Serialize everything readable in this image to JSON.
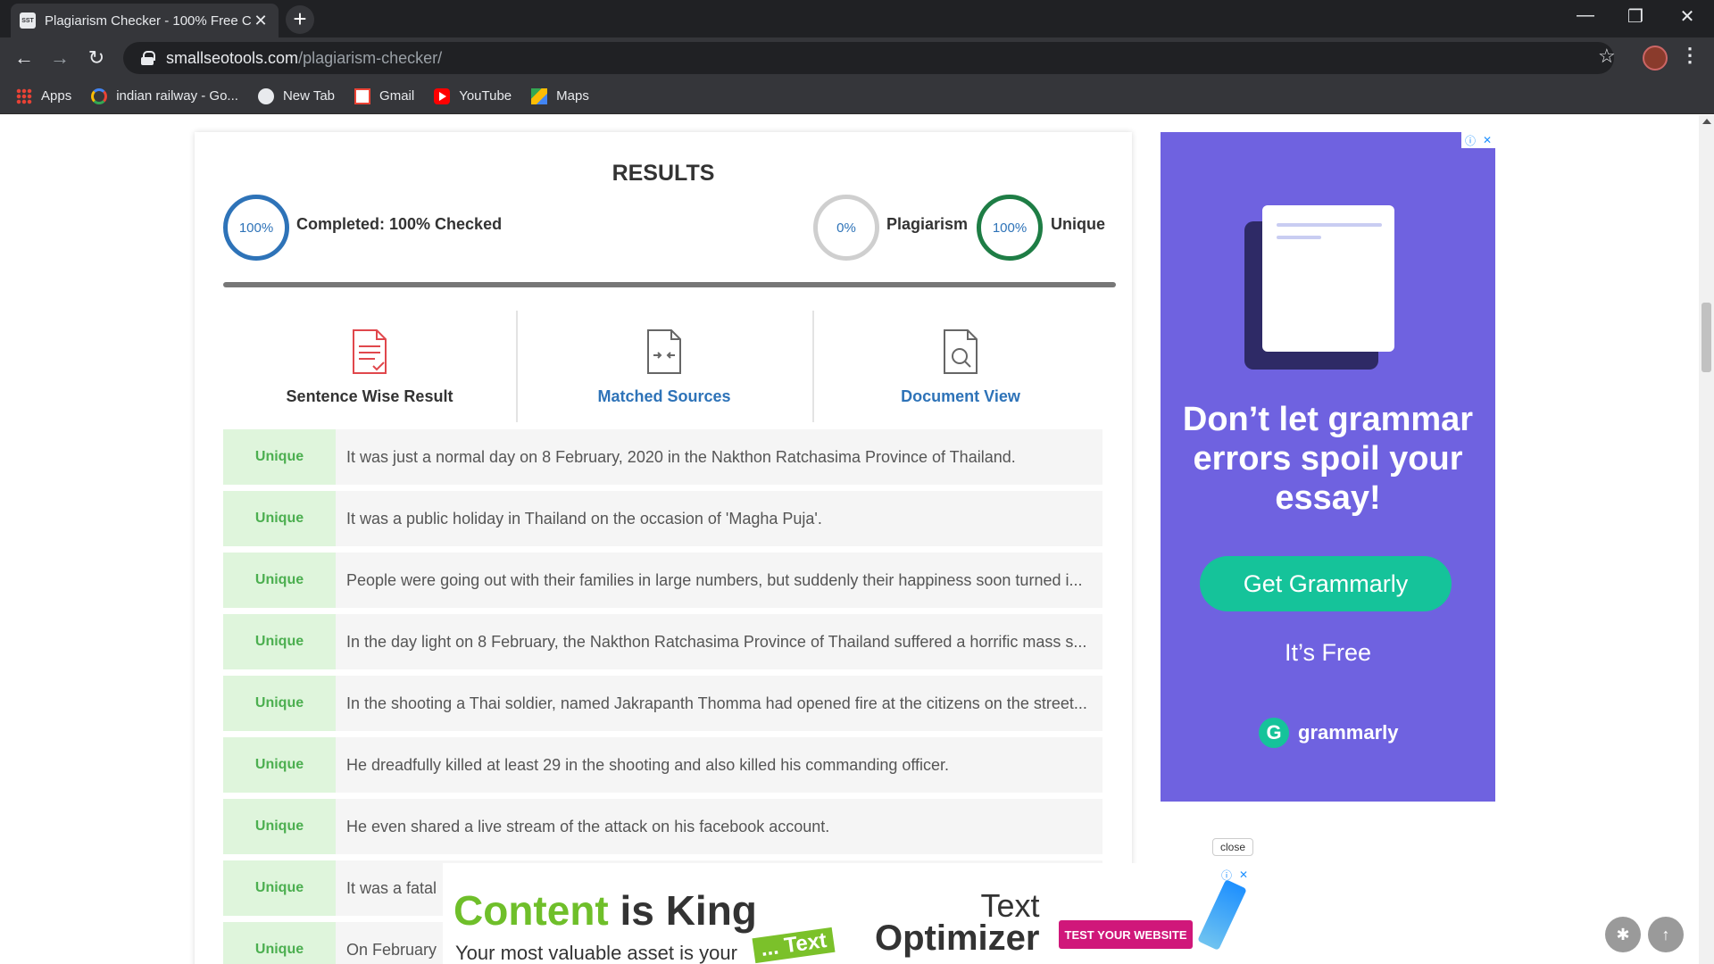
{
  "browser": {
    "tab_title": "Plagiarism Checker - 100% Free C",
    "tab_favicon_text": "SST",
    "url_host": "smallseotools.com",
    "url_path": "/plagiarism-checker/",
    "bookmarks": [
      "Apps",
      "indian railway - Go...",
      "New Tab",
      "Gmail",
      "YouTube",
      "Maps"
    ]
  },
  "results": {
    "heading": "RESULTS",
    "completed_percent": "100%",
    "completed_label": "Completed: 100% Checked",
    "plagiarism_percent": "0%",
    "plagiarism_label": "Plagiarism",
    "unique_percent": "100%",
    "unique_label": "Unique",
    "progress_fraction": 1.0
  },
  "view_tabs": [
    {
      "label": "Sentence Wise Result",
      "active": true,
      "icon": "sentence-document-icon"
    },
    {
      "label": "Matched Sources",
      "active": false,
      "icon": "compare-document-icon"
    },
    {
      "label": "Document View",
      "active": false,
      "icon": "search-document-icon"
    }
  ],
  "sentences": [
    {
      "status": "Unique",
      "text": "It was just a normal day on 8 February, 2020 in the Nakthon Ratchasima Province of Thailand."
    },
    {
      "status": "Unique",
      "text": "It was a public holiday in Thailand on the occasion of 'Magha Puja'."
    },
    {
      "status": "Unique",
      "text": "People were going out with their families in large numbers, but suddenly their happiness soon turned i..."
    },
    {
      "status": "Unique",
      "text": "In the day light on 8 February, the Nakthon Ratchasima Province of Thailand suffered a horrific mass s..."
    },
    {
      "status": "Unique",
      "text": "In the shooting a Thai soldier, named Jakrapanth Thomma had opened fire at the citizens on the street..."
    },
    {
      "status": "Unique",
      "text": "He dreadfully killed at least 29 in the shooting and also killed his commanding officer."
    },
    {
      "status": "Unique",
      "text": "He even shared a live stream of the attack on his facebook account."
    },
    {
      "status": "Unique",
      "text": "It was a fatal"
    },
    {
      "status": "Unique",
      "text": "On February"
    }
  ],
  "ad_right": {
    "headline": "Don’t let grammar errors spoil your essay!",
    "button": "Get Grammarly",
    "free": "It’s Free",
    "brand": "grammarly",
    "brand_color": "#15c39a",
    "bg_color": "#6f62e0"
  },
  "ad_bottom": {
    "close": "close",
    "title_a": "Content",
    "title_b": "is",
    "title_c": "King",
    "subtitle": "Your most valuable asset is your",
    "tag": "... Text",
    "product_a": "Text",
    "product_b": "Optimizer",
    "cta": "TEST YOUR WEBSITE"
  }
}
